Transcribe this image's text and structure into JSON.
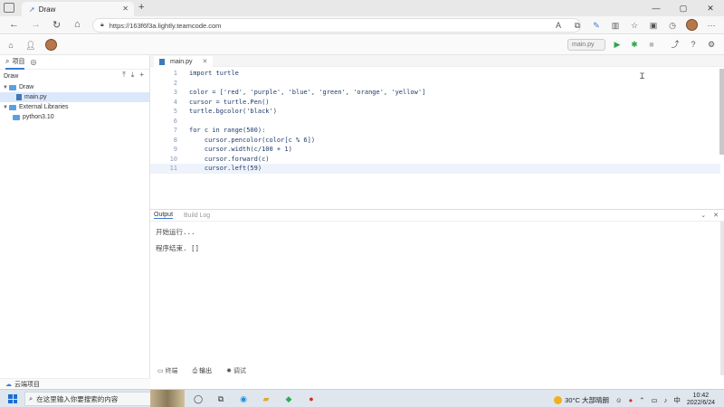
{
  "browser": {
    "tab_title": "Draw",
    "tab_close": "✕",
    "new_tab": "+",
    "url": "https://163f6f3a.lightly.teamcode.com",
    "window_controls": [
      "—",
      "▢",
      "✕"
    ]
  },
  "app": {
    "run_target": "main.py"
  },
  "sidebar": {
    "tab_project": "项目",
    "project_name": "Draw",
    "tree": [
      {
        "label": "Draw",
        "type": "folder",
        "depth": 0,
        "expanded": true
      },
      {
        "label": "main.py",
        "type": "file",
        "depth": 1,
        "selected": true
      },
      {
        "label": "External Libraries",
        "type": "folder",
        "depth": 0,
        "expanded": true
      },
      {
        "label": "python3.10",
        "type": "folder",
        "depth": 1
      }
    ],
    "bottom_label": "云端项目"
  },
  "editor": {
    "tab_name": "main.py",
    "tab_close": "✕",
    "lines": [
      {
        "n": "1",
        "text": "import turtle"
      },
      {
        "n": "2",
        "text": ""
      },
      {
        "n": "3",
        "text": "color = ['red', 'purple', 'blue', 'green', 'orange', 'yellow']"
      },
      {
        "n": "4",
        "text": "cursor = turtle.Pen()"
      },
      {
        "n": "5",
        "text": "turtle.bgcolor('black')"
      },
      {
        "n": "6",
        "text": ""
      },
      {
        "n": "7",
        "text": "for c in range(500):"
      },
      {
        "n": "8",
        "text": "    cursor.pencolor(color[c % 6])"
      },
      {
        "n": "9",
        "text": "    cursor.width(c/100 + 1)"
      },
      {
        "n": "10",
        "text": "    cursor.forward(c)"
      },
      {
        "n": "11",
        "text": "    cursor.left(59)"
      }
    ]
  },
  "panel": {
    "tab_output": "Output",
    "tab_build": "Build Log",
    "output_lines": [
      "开始运行...",
      "程序结束. []"
    ],
    "bottom_tabs": [
      "终端",
      "输出",
      "调试"
    ]
  },
  "taskbar": {
    "search_placeholder": "在这里输入你要搜索的内容",
    "weather": "30°C 大部晴朗",
    "time": "10:42",
    "date": "2022/6/24"
  }
}
